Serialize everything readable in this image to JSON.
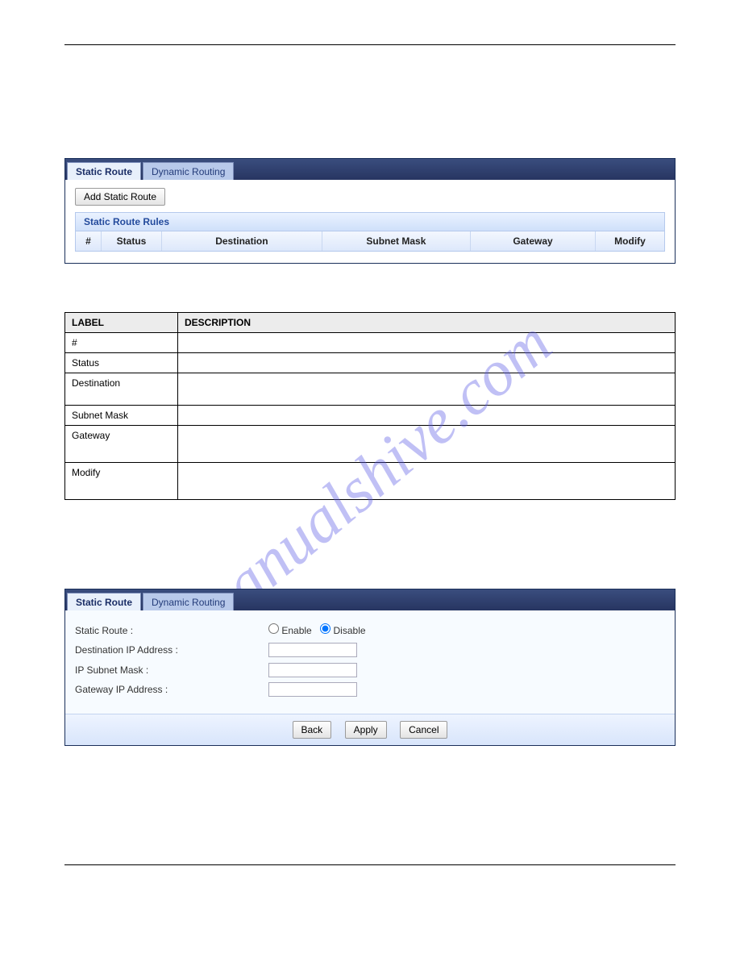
{
  "watermark": "manualshive.com",
  "panel1": {
    "tabs": {
      "active": "Static Route",
      "other": "Dynamic Routing"
    },
    "addButton": "Add Static Route",
    "sectionTitle": "Static Route Rules",
    "columns": {
      "num": "#",
      "status": "Status",
      "destination": "Destination",
      "mask": "Subnet Mask",
      "gateway": "Gateway",
      "modify": "Modify"
    }
  },
  "descTable": {
    "head": {
      "label": "LABEL",
      "desc": "DESCRIPTION"
    },
    "rows": [
      {
        "label": "#",
        "desc": ""
      },
      {
        "label": "Status",
        "desc": ""
      },
      {
        "label": "Destination",
        "desc": ""
      },
      {
        "label": "Subnet Mask",
        "desc": ""
      },
      {
        "label": "Gateway",
        "desc": ""
      },
      {
        "label": "Modify",
        "desc": ""
      }
    ]
  },
  "panel2": {
    "tabs": {
      "active": "Static Route",
      "other": "Dynamic Routing"
    },
    "fields": {
      "staticRoute": "Static Route :",
      "enable": "Enable",
      "disable": "Disable",
      "destIP": "Destination IP Address :",
      "subnet": "IP Subnet Mask :",
      "gatewayIP": "Gateway IP Address :"
    },
    "buttons": {
      "back": "Back",
      "apply": "Apply",
      "cancel": "Cancel"
    }
  }
}
